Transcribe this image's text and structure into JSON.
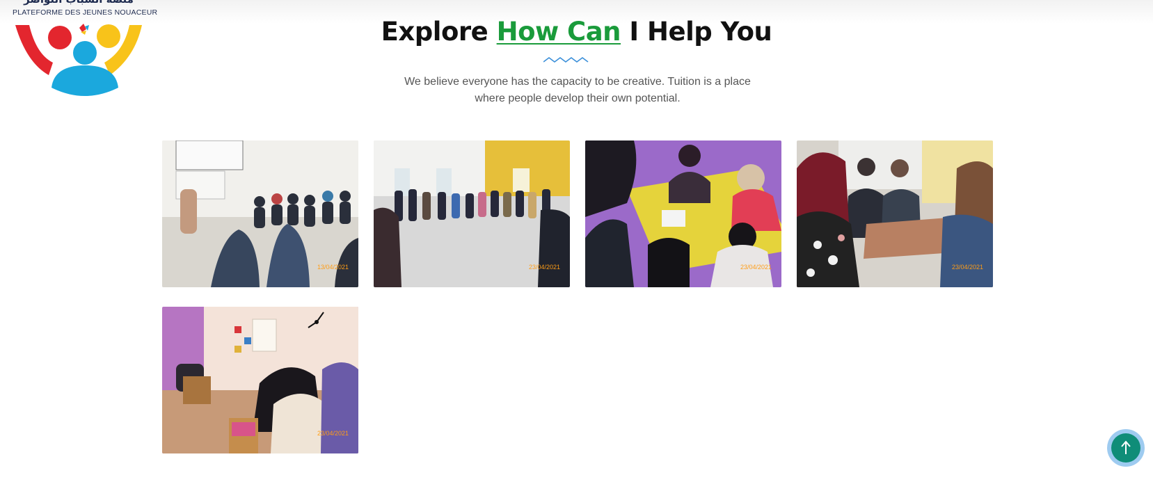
{
  "logo": {
    "arabic_text": "منصة الشباب النواصر",
    "french_text": "PLATEFORME DES JEUNES NOUACEUR"
  },
  "section": {
    "heading_start": "Explore ",
    "heading_accent": "How Can",
    "heading_end": " I Help You",
    "intro": "We believe everyone has the capacity to be creative. Tuition is a place where people develop their own potential."
  },
  "gallery": [
    {
      "icon": "photo",
      "date": "13/04/2021"
    },
    {
      "icon": "photo",
      "date": "23/04/2021"
    },
    {
      "icon": "photo",
      "date": "23/04/2021"
    },
    {
      "icon": "photo",
      "date": "23/04/2021"
    },
    {
      "icon": "photo",
      "date": "23/04/2021"
    }
  ],
  "back_to_top": {
    "icon": "arrow-up-icon"
  },
  "colors": {
    "accent_green": "#1a9b3b",
    "wave_blue": "#3b8fd9",
    "back_to_top_bg": "#0f8d78"
  }
}
